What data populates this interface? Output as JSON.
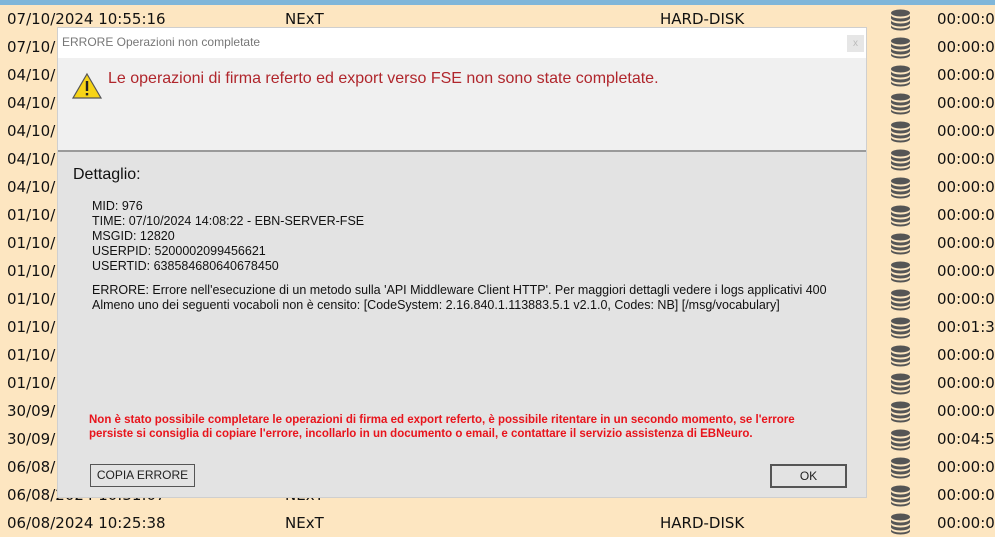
{
  "rows": [
    {
      "date": "07/10/2024 10:55:16",
      "source": "NExT",
      "device": "HARD-DISK",
      "time": "00:00:0"
    },
    {
      "date": "07/10/",
      "time": "00:00:0"
    },
    {
      "date": "04/10/",
      "time": "00:00:0"
    },
    {
      "date": "04/10/",
      "time": "00:00:0"
    },
    {
      "date": "04/10/",
      "time": "00:00:0"
    },
    {
      "date": "04/10/",
      "time": "00:00:0"
    },
    {
      "date": "04/10/",
      "time": "00:00:0"
    },
    {
      "date": "01/10/",
      "time": "00:00:0"
    },
    {
      "date": "01/10/",
      "time": "00:00:0"
    },
    {
      "date": "01/10/",
      "time": "00:00:0"
    },
    {
      "date": "01/10/",
      "time": "00:00:0"
    },
    {
      "date": "01/10/",
      "time": "00:01:3"
    },
    {
      "date": "01/10/",
      "time": "00:00:0"
    },
    {
      "date": "01/10/",
      "time": "00:00:0"
    },
    {
      "date": "30/09/",
      "time": "00:00:0"
    },
    {
      "date": "30/09/",
      "time": "00:04:5"
    },
    {
      "date": "06/08/",
      "time": "00:00:0"
    },
    {
      "date": "06/08/2024 10:31:07",
      "source": "NExT",
      "time": "00:00:0"
    },
    {
      "date": "06/08/2024 10:25:38",
      "source": "NExT",
      "device": "HARD-DISK",
      "time": "00:00:0"
    }
  ],
  "dialog": {
    "title": "ERRORE Operazioni non completate",
    "close": "x",
    "message": "Le operazioni di firma referto ed export verso FSE non sono state completate.",
    "detail_label": "Dettaglio:",
    "mid": "MID: 976",
    "time": "TIME: 07/10/2024 14:08:22 - EBN-SERVER-FSE",
    "msgid": "MSGID: 12820",
    "userpid": "USERPID: 5200002099456621",
    "usertid": "USERTID: 638584680640678450",
    "error": "ERRORE: Errore nell'esecuzione di un metodo sulla 'API Middleware Client HTTP'. Per maggiori dettagli vedere i logs applicativi 400 Almeno uno dei seguenti vocaboli non è censito: [CodeSystem: 2.16.840.1.113883.5.1 v2.1.0, Codes: NB] [/msg/vocabulary]",
    "notice": "Non è stato possibile completare le operazioni di firma ed export referto, è possibile ritentare in un secondo momento, se l'errore persiste si consiglia di copiare l'errore, incollarlo in un documento o email, e contattare il servizio assistenza di EBNeuro.",
    "copy_button": "COPIA ERRORE",
    "ok_button": "OK"
  },
  "colors": {
    "row_bg": "#fde6c1",
    "error_red": "#e8141c",
    "header_red": "#b0262c"
  }
}
